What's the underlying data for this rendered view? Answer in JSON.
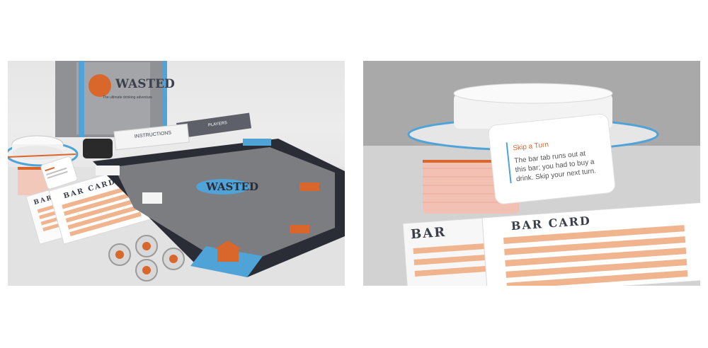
{
  "left_photo": {
    "box": {
      "brand": "WASTED",
      "tagline": "The ultimate drinking adventure"
    },
    "instructions_label": "INSTRUCTIONS",
    "players_label": "PLAYERS",
    "board_logo": "WASTED",
    "bar_card_title": "BAR CARD",
    "colors": {
      "accent_blue": "#4fa3d6",
      "accent_orange": "#d9662b",
      "board_grey": "#7b7d80",
      "track_dark": "#2a2d36"
    }
  },
  "right_photo": {
    "card_title": "Skip a Turn",
    "card_body_lines": [
      "The bar tab runs out at",
      "this bar; you had to buy a",
      "drink. Skip your next turn."
    ],
    "bar_card_title": "BAR CARD",
    "bar_card_title_partial": "BAR"
  }
}
